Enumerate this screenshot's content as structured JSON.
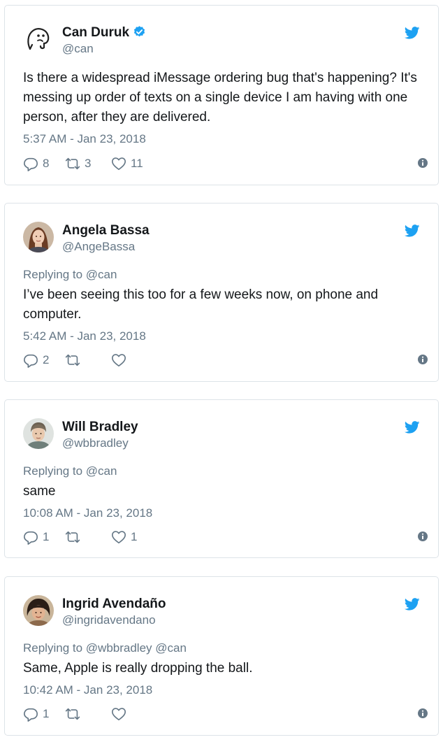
{
  "colors": {
    "twitter_blue": "#1da1f2",
    "secondary_text": "#657786",
    "primary_text": "#14171a",
    "card_border": "#dde3e8"
  },
  "icons": {
    "reply": "reply-icon",
    "retweet": "retweet-icon",
    "like": "heart-icon",
    "info": "info-icon",
    "brand": "twitter-bird-icon",
    "verified": "verified-badge-icon"
  },
  "tweets": [
    {
      "name": "Can Duruk",
      "handle": "@can",
      "verified": true,
      "replying_prefix": "",
      "replying_to": "",
      "text": "Is there a widespread iMessage ordering bug that's happening? It's messing up order of texts on a single device I am having with one person, after they are delivered.",
      "time": "5:37 AM - Jan 23, 2018",
      "replies": "8",
      "retweets": "3",
      "likes": "11"
    },
    {
      "name": "Angela Bassa",
      "handle": "@AngeBassa",
      "verified": false,
      "replying_prefix": "Replying to",
      "replying_to": "@can",
      "text": "I’ve been seeing this too for a few weeks now, on phone and computer.",
      "time": "5:42 AM - Jan 23, 2018",
      "replies": "2",
      "retweets": "",
      "likes": ""
    },
    {
      "name": "Will Bradley",
      "handle": "@wbbradley",
      "verified": false,
      "replying_prefix": "Replying to",
      "replying_to": "@can",
      "text": "same",
      "time": "10:08 AM - Jan 23, 2018",
      "replies": "1",
      "retweets": "",
      "likes": "1"
    },
    {
      "name": "Ingrid Avendaño",
      "handle": "@ingridavendano",
      "verified": false,
      "replying_prefix": "Replying to",
      "replying_to": "@wbbradley @can",
      "text": "Same, Apple is really dropping the ball.",
      "time": "10:42 AM - Jan 23, 2018",
      "replies": "1",
      "retweets": "",
      "likes": ""
    }
  ]
}
